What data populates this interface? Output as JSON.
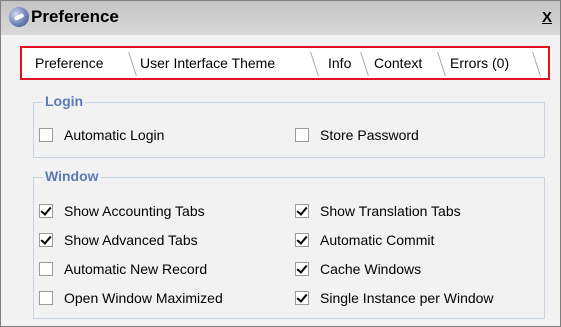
{
  "window": {
    "title": "Preference",
    "close_glyph": "X"
  },
  "tabs": [
    {
      "label": "Preference",
      "active": true
    },
    {
      "label": "User Interface Theme",
      "active": false
    },
    {
      "label": "Info",
      "active": false
    },
    {
      "label": "Context",
      "active": false
    },
    {
      "label": "Errors (0)",
      "active": false
    }
  ],
  "groups": {
    "login": {
      "title": "Login",
      "items": [
        {
          "label": "Automatic Login",
          "checked": false
        },
        {
          "label": "Store Password",
          "checked": false
        }
      ]
    },
    "window": {
      "title": "Window",
      "items": [
        {
          "label": "Show Accounting Tabs",
          "checked": true
        },
        {
          "label": "Show Translation Tabs",
          "checked": true
        },
        {
          "label": "Show Advanced Tabs",
          "checked": true
        },
        {
          "label": "Automatic Commit",
          "checked": true
        },
        {
          "label": "Automatic New Record",
          "checked": false
        },
        {
          "label": "Cache Windows",
          "checked": true
        },
        {
          "label": "Open Window Maximized",
          "checked": false
        },
        {
          "label": "Single Instance per Window",
          "checked": true
        }
      ]
    }
  },
  "colors": {
    "highlight_border": "#e0141e",
    "group_title": "#5b7ab5"
  },
  "icons": {
    "app": "app-logo-icon",
    "close": "close-icon",
    "check": "checkmark-icon"
  }
}
